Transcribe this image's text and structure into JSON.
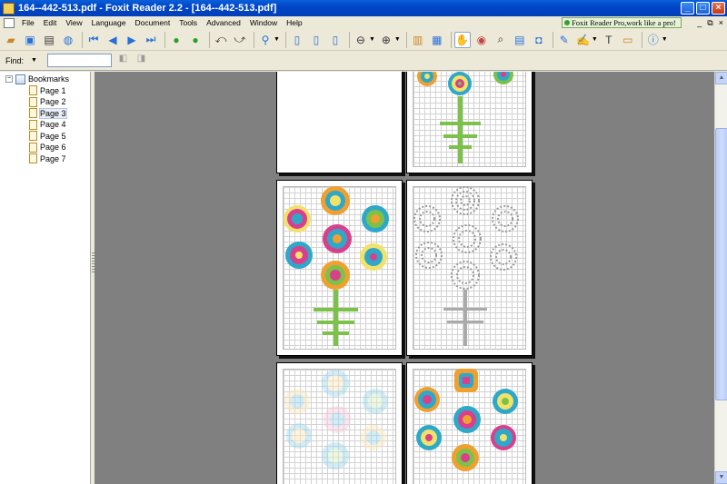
{
  "window": {
    "title": "164--442-513.pdf - Foxit Reader 2.2 - [164--442-513.pdf]",
    "buttons": {
      "minimize": "_",
      "maximize": "□",
      "close": "×"
    }
  },
  "menu": {
    "items": [
      "File",
      "Edit",
      "View",
      "Language",
      "Document",
      "Tools",
      "Advanced",
      "Window",
      "Help"
    ],
    "promo": "Foxit Reader Pro,work like a pro!",
    "mdi": {
      "minimize": "_",
      "restore": "⧉",
      "close": "×"
    }
  },
  "find": {
    "label": "Find:",
    "value": "",
    "dropdown": "▼"
  },
  "bookmarks": {
    "root": "Bookmarks",
    "expander": "−",
    "pages": [
      "Page 1",
      "Page 2",
      "Page 3",
      "Page 4",
      "Page 5",
      "Page 6",
      "Page 7"
    ],
    "selected_index": 2
  },
  "toolbar_icons": [
    "open-icon",
    "save-icon",
    "print-icon",
    "email-icon",
    "first-page-icon",
    "prev-page-icon",
    "next-page-icon",
    "last-page-icon",
    "go-back-icon",
    "go-forward-icon",
    "rotate-left-icon",
    "rotate-right-icon",
    "zoom-tool-icon",
    "actual-size-icon",
    "fit-page-icon",
    "fit-width-icon",
    "zoom-out-icon",
    "zoom-in-icon",
    "single-page-icon",
    "continuous-icon",
    "hand-tool-icon",
    "snapshot-icon",
    "find-icon",
    "select-text-icon",
    "camera-icon",
    "pencil-icon",
    "highlight-icon",
    "typewriter-icon",
    "note-icon",
    "info-icon"
  ],
  "colors": {
    "viewer_bg": "#808080",
    "teal": "#2EA8C8",
    "orange": "#F0A030",
    "pink": "#D8408C",
    "green": "#7CC24A",
    "yellow": "#F2E26A",
    "light_blue": "#9ED8EE",
    "gray_pattern": "#9A9A9A"
  }
}
